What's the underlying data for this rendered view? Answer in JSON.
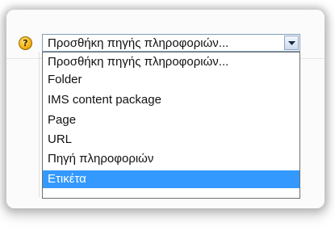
{
  "select": {
    "current_value": "Προσθήκη πηγής πληροφοριών...",
    "help_glyph": "?",
    "icon": "chevron-down-icon"
  },
  "dropdown": {
    "options": [
      {
        "label": "Προσθήκη πηγής πληροφοριών..."
      },
      {
        "label": "Folder"
      },
      {
        "label": "IMS content package"
      },
      {
        "label": "Page"
      },
      {
        "label": "URL"
      },
      {
        "label": "Πηγή πληροφοριών"
      },
      {
        "label": "Ετικέτα",
        "highlighted": true
      }
    ]
  },
  "colors": {
    "highlight": "#3399ff",
    "help_icon": "#f3b617"
  }
}
